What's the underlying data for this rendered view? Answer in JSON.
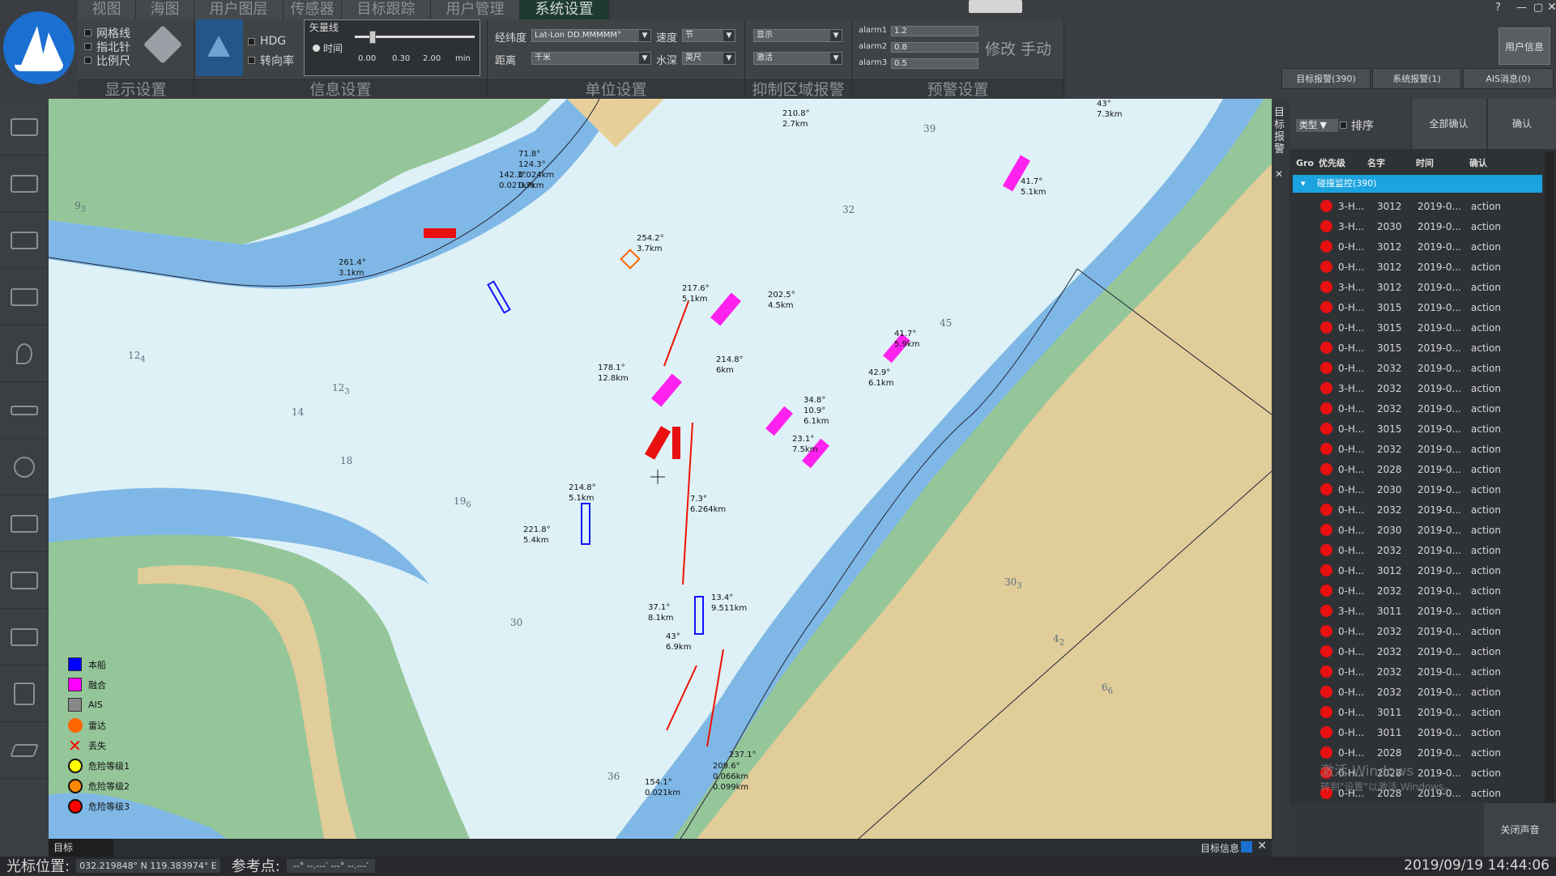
{
  "menu": {
    "tabs": [
      "视图",
      "海图",
      "用户图层",
      "传感器",
      "目标跟踪",
      "用户管理",
      "系统设置"
    ],
    "active_index": 6
  },
  "display_settings": {
    "label": "显示设置",
    "grid": "网格线",
    "compass": "指北针",
    "scale": "比例尺"
  },
  "info_settings": {
    "label": "信息设置",
    "hdg": "HDG",
    "rot": "转向率",
    "vector_title": "矢量线",
    "time_label": "时间",
    "ticks": [
      "0.00",
      "0.30",
      "2.00"
    ],
    "unit": "min"
  },
  "unit_settings": {
    "label": "单位设置",
    "latlon_label": "经纬度",
    "latlon_value": "Lat-Lon DD.MMMMM°",
    "distance_label": "距离",
    "distance_value": "千米",
    "speed_label": "速度",
    "speed_value": "节",
    "depth_label": "水深",
    "depth_value": "英尺"
  },
  "suppress": {
    "label": "抑制区域报警",
    "display_value": "显示",
    "activate_value": "激活"
  },
  "warning": {
    "label": "预警设置",
    "alarm1_label": "alarm1",
    "alarm1": "1.2",
    "alarm2_label": "alarm2",
    "alarm2": "0.8",
    "alarm3_label": "alarm3",
    "alarm3": "0.5",
    "modify": "修改",
    "manual": "手动"
  },
  "user_info": "用户信息",
  "right_tabs": [
    "目标报警(390)",
    "系统报警(1)",
    "AIS消息(0)"
  ],
  "right_panel": {
    "vertical_tab": "目标报警",
    "type_label": "类型",
    "sort_label": "排序",
    "confirm_all": "全部确认",
    "confirm": "确认",
    "columns": [
      "Gro",
      "优先级",
      "名字",
      "时间",
      "确认"
    ],
    "group_label": "碰撞监控(390)",
    "rows": [
      {
        "p": "3-H...",
        "n": "3012",
        "t": "2019-0...",
        "a": "action"
      },
      {
        "p": "3-H...",
        "n": "2030",
        "t": "2019-0...",
        "a": "action"
      },
      {
        "p": "0-H...",
        "n": "3012",
        "t": "2019-0...",
        "a": "action"
      },
      {
        "p": "0-H...",
        "n": "3012",
        "t": "2019-0...",
        "a": "action"
      },
      {
        "p": "3-H...",
        "n": "3012",
        "t": "2019-0...",
        "a": "action"
      },
      {
        "p": "0-H...",
        "n": "3015",
        "t": "2019-0...",
        "a": "action"
      },
      {
        "p": "0-H...",
        "n": "3015",
        "t": "2019-0...",
        "a": "action"
      },
      {
        "p": "0-H...",
        "n": "3015",
        "t": "2019-0...",
        "a": "action"
      },
      {
        "p": "0-H...",
        "n": "2032",
        "t": "2019-0...",
        "a": "action"
      },
      {
        "p": "3-H...",
        "n": "2032",
        "t": "2019-0...",
        "a": "action"
      },
      {
        "p": "0-H...",
        "n": "2032",
        "t": "2019-0...",
        "a": "action"
      },
      {
        "p": "0-H...",
        "n": "3015",
        "t": "2019-0...",
        "a": "action"
      },
      {
        "p": "0-H...",
        "n": "2032",
        "t": "2019-0...",
        "a": "action"
      },
      {
        "p": "0-H...",
        "n": "2028",
        "t": "2019-0...",
        "a": "action"
      },
      {
        "p": "0-H...",
        "n": "2030",
        "t": "2019-0...",
        "a": "action"
      },
      {
        "p": "0-H...",
        "n": "2032",
        "t": "2019-0...",
        "a": "action"
      },
      {
        "p": "0-H...",
        "n": "2030",
        "t": "2019-0...",
        "a": "action"
      },
      {
        "p": "0-H...",
        "n": "2032",
        "t": "2019-0...",
        "a": "action"
      },
      {
        "p": "0-H...",
        "n": "3012",
        "t": "2019-0...",
        "a": "action"
      },
      {
        "p": "0-H...",
        "n": "2032",
        "t": "2019-0...",
        "a": "action"
      },
      {
        "p": "3-H...",
        "n": "3011",
        "t": "2019-0...",
        "a": "action"
      },
      {
        "p": "0-H...",
        "n": "2032",
        "t": "2019-0...",
        "a": "action"
      },
      {
        "p": "0-H...",
        "n": "2032",
        "t": "2019-0...",
        "a": "action"
      },
      {
        "p": "0-H...",
        "n": "2032",
        "t": "2019-0...",
        "a": "action"
      },
      {
        "p": "0-H...",
        "n": "2032",
        "t": "2019-0...",
        "a": "action"
      },
      {
        "p": "0-H...",
        "n": "3011",
        "t": "2019-0...",
        "a": "action"
      },
      {
        "p": "0-H...",
        "n": "3011",
        "t": "2019-0...",
        "a": "action"
      },
      {
        "p": "0-H...",
        "n": "2028",
        "t": "2019-0...",
        "a": "action"
      },
      {
        "p": "0-H...",
        "n": "2028",
        "t": "2019-0...",
        "a": "action"
      },
      {
        "p": "0-H...",
        "n": "2028",
        "t": "2019-0...",
        "a": "action"
      }
    ],
    "watermark_line1": "激活 Windows",
    "watermark_line2": "转到\"设置\"以激活 Windows。",
    "close_sound": "关闭声音"
  },
  "legend": [
    {
      "label": "本船",
      "color": "#0000ff",
      "shape": "square"
    },
    {
      "label": "融合",
      "color": "#ff00ff",
      "shape": "square"
    },
    {
      "label": "AIS",
      "color": "#888888",
      "shape": "square"
    },
    {
      "label": "雷达",
      "color": "#ff6600",
      "shape": "circle"
    },
    {
      "label": "丢失",
      "color": "#ff0000",
      "shape": "cross"
    },
    {
      "label": "危险等级1",
      "color": "#ffff00",
      "shape": "circle"
    },
    {
      "label": "危险等级2",
      "color": "#ff8800",
      "shape": "circle"
    },
    {
      "label": "危险等级3",
      "color": "#ff0000",
      "shape": "circle"
    }
  ],
  "targets": [
    "210.8°",
    "2.7km",
    "71.8°",
    "124.3°",
    "0.024km",
    "0.7km",
    "142.3°",
    "0.021km",
    "254.2°",
    "3.7km",
    "261.4°",
    "3.1km",
    "217.6°",
    "5.1km",
    "202.5°",
    "4.5km",
    "178.1°",
    "12.8km",
    "214.8°",
    "6km",
    "41.7°",
    "5.9km",
    "42.9°",
    "6.1km",
    "34.8°",
    "10.9°",
    "6.1km",
    "23.1°",
    "7.5km",
    "7.3°",
    "6.264km",
    "214.8°",
    "5.1km",
    "221.8°",
    "5.4km",
    "37.1°",
    "8.1km",
    "13.4°",
    "9.511km",
    "43°",
    "6.9km",
    "41.7°",
    "5.1km",
    "43°",
    "7.3km",
    "209.6°",
    "0.066km",
    "0.099km",
    "154.1°",
    "0.021km",
    "237.1°"
  ],
  "map_bottom": {
    "left": "目标",
    "right": "目标信息"
  },
  "status": {
    "cursor_label": "光标位置:",
    "cursor_value": "032.219848° N 119.383974° E",
    "ref_label": "参考点:",
    "ref_value": "--° --.---′ ---° --.---′",
    "datetime": "2019/09/19 14:44:06"
  }
}
